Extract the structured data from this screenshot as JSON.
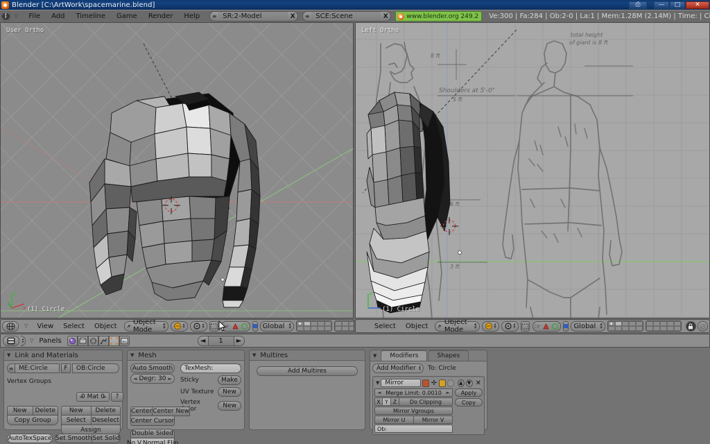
{
  "window": {
    "title": "Blender [C:\\ArtWork\\spacemarine.blend]",
    "app_icon": "blender-logo-icon",
    "controls": {
      "restore_extra": "⎙",
      "minimize": "—",
      "maximize": "□",
      "close": "✕"
    }
  },
  "menubar": {
    "window_type_icon": "info-window-icon",
    "collapse_icon": "chevron-down-icon",
    "items": [
      "File",
      "Add",
      "Timeline",
      "Game",
      "Render",
      "Help"
    ],
    "screen_field": {
      "value": "SR:2-Model",
      "close_label": "X",
      "browse_icon": "browse-icon"
    },
    "scene_field": {
      "value": "SCE:Scene",
      "close_label": "X",
      "browse_icon": "browse-icon"
    },
    "version_badge": {
      "label": "www.blender.org 249.2",
      "color": "#7fc24a"
    },
    "stats": "Ve:300 | Fa:284 | Ob:2-0 | La:1  | Mem:1.28M (2.14M)  | Time: | Circle"
  },
  "viewports": [
    {
      "id": "left",
      "view_label": "User Ortho",
      "object_label": "(1) Circle",
      "background": "#8b8b8b",
      "header": {
        "window_type_icon": "3d-view-icon",
        "collapse_icon": "chevron-down-icon",
        "menus": [
          "View",
          "Select",
          "Object"
        ],
        "mode": "Object Mode",
        "mode_icon": "object-mode-icon",
        "draw_type_icon": "solid-shading-icon",
        "pivot_icon": "pivot-median-icon",
        "snap_icon": "snap-icon",
        "manipulator_icons": [
          "hand-translate-icon",
          "rotate-icon",
          "scale-icon"
        ],
        "transform_orientation": "Global",
        "layers_label": "layer-grid"
      }
    },
    {
      "id": "right",
      "view_label": "Left Ortho",
      "object_label": "(1) Circle",
      "background": "#a8a8a8",
      "header": {
        "menus": [
          "Select",
          "Object"
        ],
        "mode": "Object Mode",
        "mode_icon": "object-mode-icon",
        "draw_type_icon": "solid-shading-icon",
        "pivot_icon": "pivot-median-icon",
        "snap_icon": "snap-icon",
        "manipulator_icons": [
          "hand-translate-icon",
          "rotate-icon",
          "scale-icon"
        ],
        "transform_orientation": "Global",
        "lock_icon": "lock-icon",
        "render_icon": "render-preview-icon",
        "bg_image_icon": "background-image-icon"
      },
      "background_reference": {
        "annotations": [
          "Shoulders at 5'-0\"",
          "5 ft",
          "Total height of giant is 8 ft",
          "6 ft",
          "3 ft"
        ]
      }
    }
  ],
  "buttons_window": {
    "header": {
      "window_type_icon": "buttons-window-icon",
      "collapse_icon": "chevron-down-icon",
      "panels_label": "Panels",
      "context_icons": [
        "shading-icon",
        "object-icon",
        "physics-icon",
        "constraints-icon",
        "editing-icon",
        "scene-icon"
      ],
      "active_context": "editing-icon",
      "frame_value": "1",
      "prev_arrow": "◄",
      "next_arrow": "►"
    },
    "panels": [
      {
        "id": "link_and_materials",
        "title": "Link and Materials",
        "mesh_field": "ME:Circle",
        "f_button": "F",
        "ob_field": "OB:Circle",
        "vertex_groups_label": "Vertex Groups",
        "material_index": "0 Mat 0",
        "help_button": "?",
        "vgroup_buttons": [
          "New",
          "Delete",
          "Copy Group"
        ],
        "material_buttons": [
          "New",
          "Delete",
          "Select",
          "Deselect",
          "Assign"
        ],
        "bottom_buttons": [
          "AutoTexSpace",
          "Set Smooth",
          "Set Solid"
        ]
      },
      {
        "id": "mesh",
        "title": "Mesh",
        "auto_smooth": "Auto Smooth",
        "degr": "Degr: 30",
        "texmesh_label": "TexMesh:",
        "rows": [
          {
            "label": "Sticky",
            "button": "Make"
          },
          {
            "label": "UV Texture",
            "button": "New"
          },
          {
            "label": "Vertex Color",
            "button": "New"
          }
        ],
        "center_buttons": [
          "Center",
          "Center New",
          "Center Cursor"
        ],
        "sided_buttons": [
          "Double Sided",
          "No V.Normal Flip"
        ]
      },
      {
        "id": "multires",
        "title": "Multires",
        "add_button": "Add Multires"
      },
      {
        "id": "modifiers",
        "tabs": [
          {
            "label": "Modifiers",
            "active": true
          },
          {
            "label": "Shapes",
            "active": false
          }
        ],
        "add_modifier": "Add Modifier",
        "to_object": "To: Circle",
        "modifier": {
          "name": "Mirror",
          "expand_icon": "triangle-down-icon",
          "display_icons": [
            "render-toggle-icon",
            "realtime-toggle-icon",
            "editmode-toggle-icon",
            "cage-toggle-icon"
          ],
          "move_up_icon": "move-up-icon",
          "move_down_icon": "move-down-icon",
          "delete_icon": "delete-x-icon",
          "merge_limit": "Merge Limit: 0.0010",
          "axis_buttons": [
            "X",
            "Y",
            "Z"
          ],
          "axis_active": "Y",
          "do_clipping": "Do Clipping",
          "mirror_vgroups": "Mirror Vgroups",
          "mirror_u": "Mirror U",
          "mirror_v": "Mirror V",
          "ob_field": "Ob:",
          "apply_button": "Apply",
          "copy_button": "Copy"
        }
      }
    ]
  }
}
